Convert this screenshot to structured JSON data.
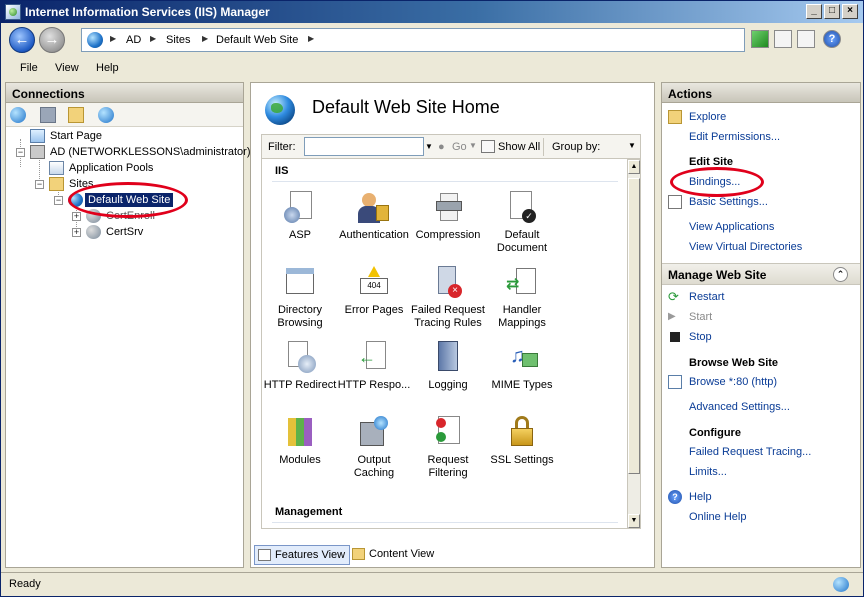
{
  "window": {
    "title": "Internet Information Services (IIS) Manager",
    "controls": [
      "_",
      "□",
      "×"
    ]
  },
  "address": {
    "crumbs": [
      "AD",
      "Sites",
      "Default Web Site"
    ]
  },
  "menu": {
    "file": "File",
    "view": "View",
    "help": "Help"
  },
  "connections": {
    "title": "Connections",
    "tree": {
      "start_page": "Start Page",
      "server": "AD (NETWORKLESSONS\\administrator)",
      "app_pools": "Application Pools",
      "sites": "Sites",
      "default_site": "Default Web Site",
      "cert_enroll": "CertEnroll",
      "cert_srv": "CertSrv"
    }
  },
  "center": {
    "title": "Default Web Site Home",
    "filter_label": "Filter:",
    "go_label": "Go",
    "show_all_label": "Show All",
    "group_by_label": "Group by:",
    "section_iis": "IIS",
    "section_management": "Management",
    "features": [
      {
        "label": "ASP",
        "icon": "asp-icon"
      },
      {
        "label": "Authentication",
        "icon": "authentication-icon"
      },
      {
        "label": "Compression",
        "icon": "compression-icon"
      },
      {
        "label": "Default Document",
        "icon": "default-document-icon"
      },
      {
        "label": "Directory Browsing",
        "icon": "directory-browsing-icon"
      },
      {
        "label": "Error Pages",
        "icon": "error-pages-icon"
      },
      {
        "label": "Failed Request Tracing Rules",
        "icon": "failed-request-tracing-icon"
      },
      {
        "label": "Handler Mappings",
        "icon": "handler-mappings-icon"
      },
      {
        "label": "HTTP Redirect",
        "icon": "http-redirect-icon"
      },
      {
        "label": "HTTP Respo...",
        "icon": "http-response-headers-icon"
      },
      {
        "label": "Logging",
        "icon": "logging-icon"
      },
      {
        "label": "MIME Types",
        "icon": "mime-types-icon"
      },
      {
        "label": "Modules",
        "icon": "modules-icon"
      },
      {
        "label": "Output Caching",
        "icon": "output-caching-icon"
      },
      {
        "label": "Request Filtering",
        "icon": "request-filtering-icon"
      },
      {
        "label": "SSL Settings",
        "icon": "ssl-settings-icon"
      }
    ],
    "error_badge": "404",
    "tabs": {
      "features_view": "Features View",
      "content_view": "Content View"
    }
  },
  "actions": {
    "title": "Actions",
    "explore": "Explore",
    "edit_permissions": "Edit Permissions...",
    "edit_site_head": "Edit Site",
    "bindings": "Bindings...",
    "basic_settings": "Basic Settings...",
    "view_applications": "View Applications",
    "view_virtual_dirs": "View Virtual Directories",
    "manage_head": "Manage Web Site",
    "restart": "Restart",
    "start": "Start",
    "stop": "Stop",
    "browse_head": "Browse Web Site",
    "browse_80": "Browse *:80 (http)",
    "advanced_settings": "Advanced Settings...",
    "configure_head": "Configure",
    "failed_request_tracing": "Failed Request Tracing...",
    "limits": "Limits...",
    "help": "Help",
    "online_help": "Online Help"
  },
  "status": {
    "text": "Ready"
  },
  "colors": {
    "highlight_ellipse": "#e0001b",
    "link": "#0a3c96",
    "selection": "#0a246a"
  }
}
